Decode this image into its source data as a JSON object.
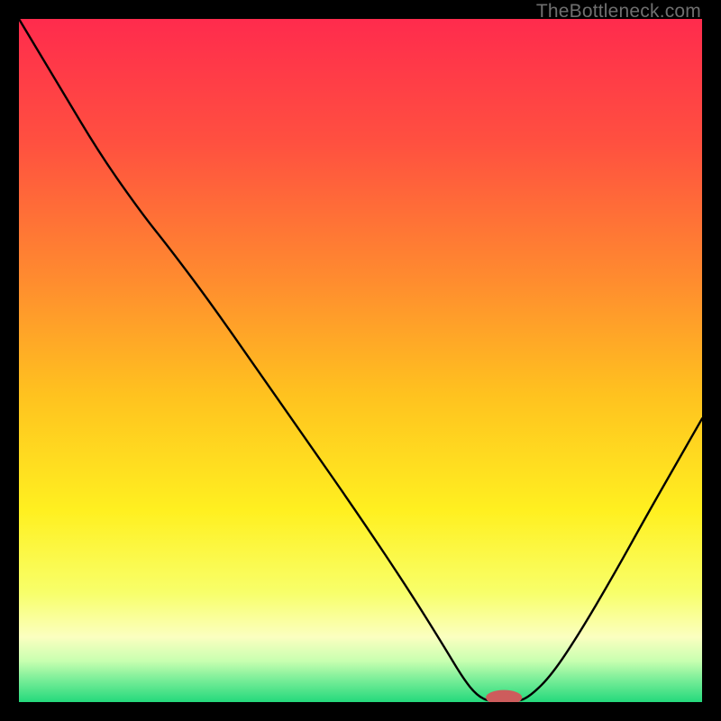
{
  "watermark": "TheBottleneck.com",
  "chart_data": {
    "type": "line",
    "title": "",
    "xlabel": "",
    "ylabel": "",
    "xlim": [
      0,
      100
    ],
    "ylim": [
      0,
      100
    ],
    "background_gradient": {
      "stops": [
        {
          "offset": 0.0,
          "color": "#ff2b4d"
        },
        {
          "offset": 0.18,
          "color": "#ff5040"
        },
        {
          "offset": 0.38,
          "color": "#ff8b2f"
        },
        {
          "offset": 0.55,
          "color": "#ffc21f"
        },
        {
          "offset": 0.72,
          "color": "#fff020"
        },
        {
          "offset": 0.84,
          "color": "#f8ff6a"
        },
        {
          "offset": 0.905,
          "color": "#fbffc0"
        },
        {
          "offset": 0.94,
          "color": "#c8ffb0"
        },
        {
          "offset": 0.965,
          "color": "#7fef9a"
        },
        {
          "offset": 1.0,
          "color": "#24d97c"
        }
      ]
    },
    "curve_points": [
      {
        "x": 0.0,
        "y": 100.0
      },
      {
        "x": 6.0,
        "y": 90.0
      },
      {
        "x": 12.0,
        "y": 80.0
      },
      {
        "x": 18.0,
        "y": 71.5
      },
      {
        "x": 22.0,
        "y": 66.5
      },
      {
        "x": 28.0,
        "y": 58.5
      },
      {
        "x": 35.0,
        "y": 48.5
      },
      {
        "x": 42.0,
        "y": 38.5
      },
      {
        "x": 50.0,
        "y": 27.0
      },
      {
        "x": 57.0,
        "y": 16.5
      },
      {
        "x": 62.0,
        "y": 8.5
      },
      {
        "x": 65.0,
        "y": 3.5
      },
      {
        "x": 67.0,
        "y": 1.0
      },
      {
        "x": 69.0,
        "y": 0.0
      },
      {
        "x": 73.0,
        "y": 0.0
      },
      {
        "x": 75.0,
        "y": 1.0
      },
      {
        "x": 78.0,
        "y": 4.0
      },
      {
        "x": 82.0,
        "y": 10.0
      },
      {
        "x": 87.0,
        "y": 18.5
      },
      {
        "x": 92.0,
        "y": 27.5
      },
      {
        "x": 96.0,
        "y": 34.5
      },
      {
        "x": 100.0,
        "y": 41.5
      }
    ],
    "marker": {
      "x": 71.0,
      "y": 0.0,
      "color": "#cd5c5c",
      "rx": 2.65,
      "ry": 1.1
    },
    "curve_stroke": "#000000",
    "curve_width": 2.4
  }
}
